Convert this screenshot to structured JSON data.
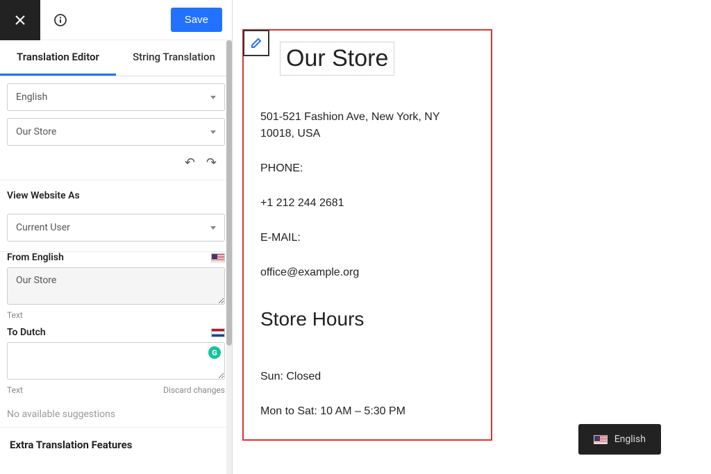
{
  "topbar": {
    "save_label": "Save"
  },
  "tabs": {
    "editor": "Translation Editor",
    "string": "String Translation"
  },
  "selects": {
    "language": "English",
    "string": "Our Store",
    "view_as_label": "View Website As",
    "view_as": "Current User"
  },
  "source": {
    "label": "From English",
    "value": "Our Store",
    "type": "Text"
  },
  "target": {
    "label": "To Dutch",
    "value": "",
    "type": "Text",
    "discard": "Discard changes"
  },
  "suggestions": "No available suggestions",
  "extra_heading": "Extra Translation Features",
  "preview": {
    "title": "Our Store",
    "address": "501-521 Fashion Ave, New York, NY 10018, USA",
    "phone_label": "PHONE:",
    "phone": "+1 212 244 2681",
    "email_label": "E-MAIL:",
    "email": "office@example.org",
    "hours_heading": "Store Hours",
    "hours_sun": "Sun: Closed",
    "hours_week": "Mon to Sat: 10 AM – 5:30 PM"
  },
  "lang_switcher": {
    "label": "English"
  }
}
